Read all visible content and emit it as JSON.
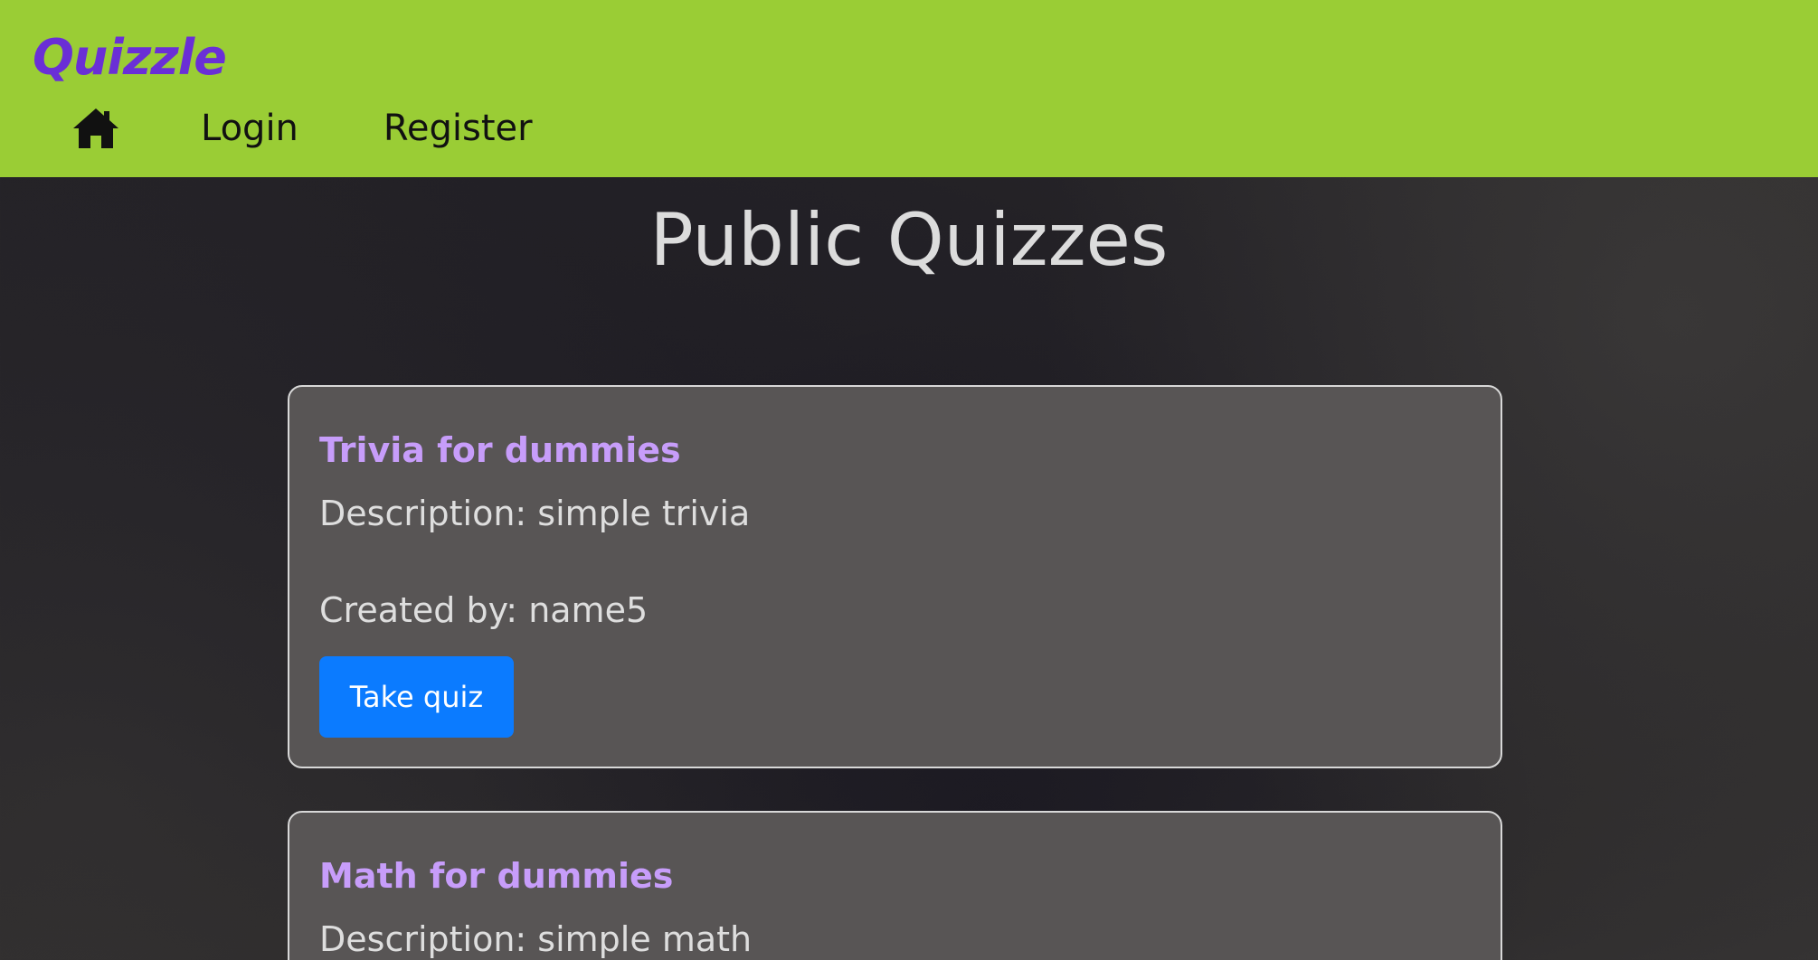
{
  "header": {
    "brand": "Quizzle",
    "nav": {
      "home_icon": "home-icon",
      "login_label": "Login",
      "register_label": "Register"
    }
  },
  "main": {
    "title": "Public Quizzes",
    "quizzes": [
      {
        "title": "Trivia for dummies",
        "description": "Description: simple trivia",
        "creator": "Created by: name5",
        "button_label": "Take quiz"
      },
      {
        "title": "Math for dummies",
        "description": "Description: simple math"
      }
    ]
  },
  "colors": {
    "header_bg": "#9acd35",
    "brand": "#6a2fd6",
    "quiz_title": "#c79dfa",
    "button": "#0b7bff",
    "card_bg": "#585555"
  }
}
